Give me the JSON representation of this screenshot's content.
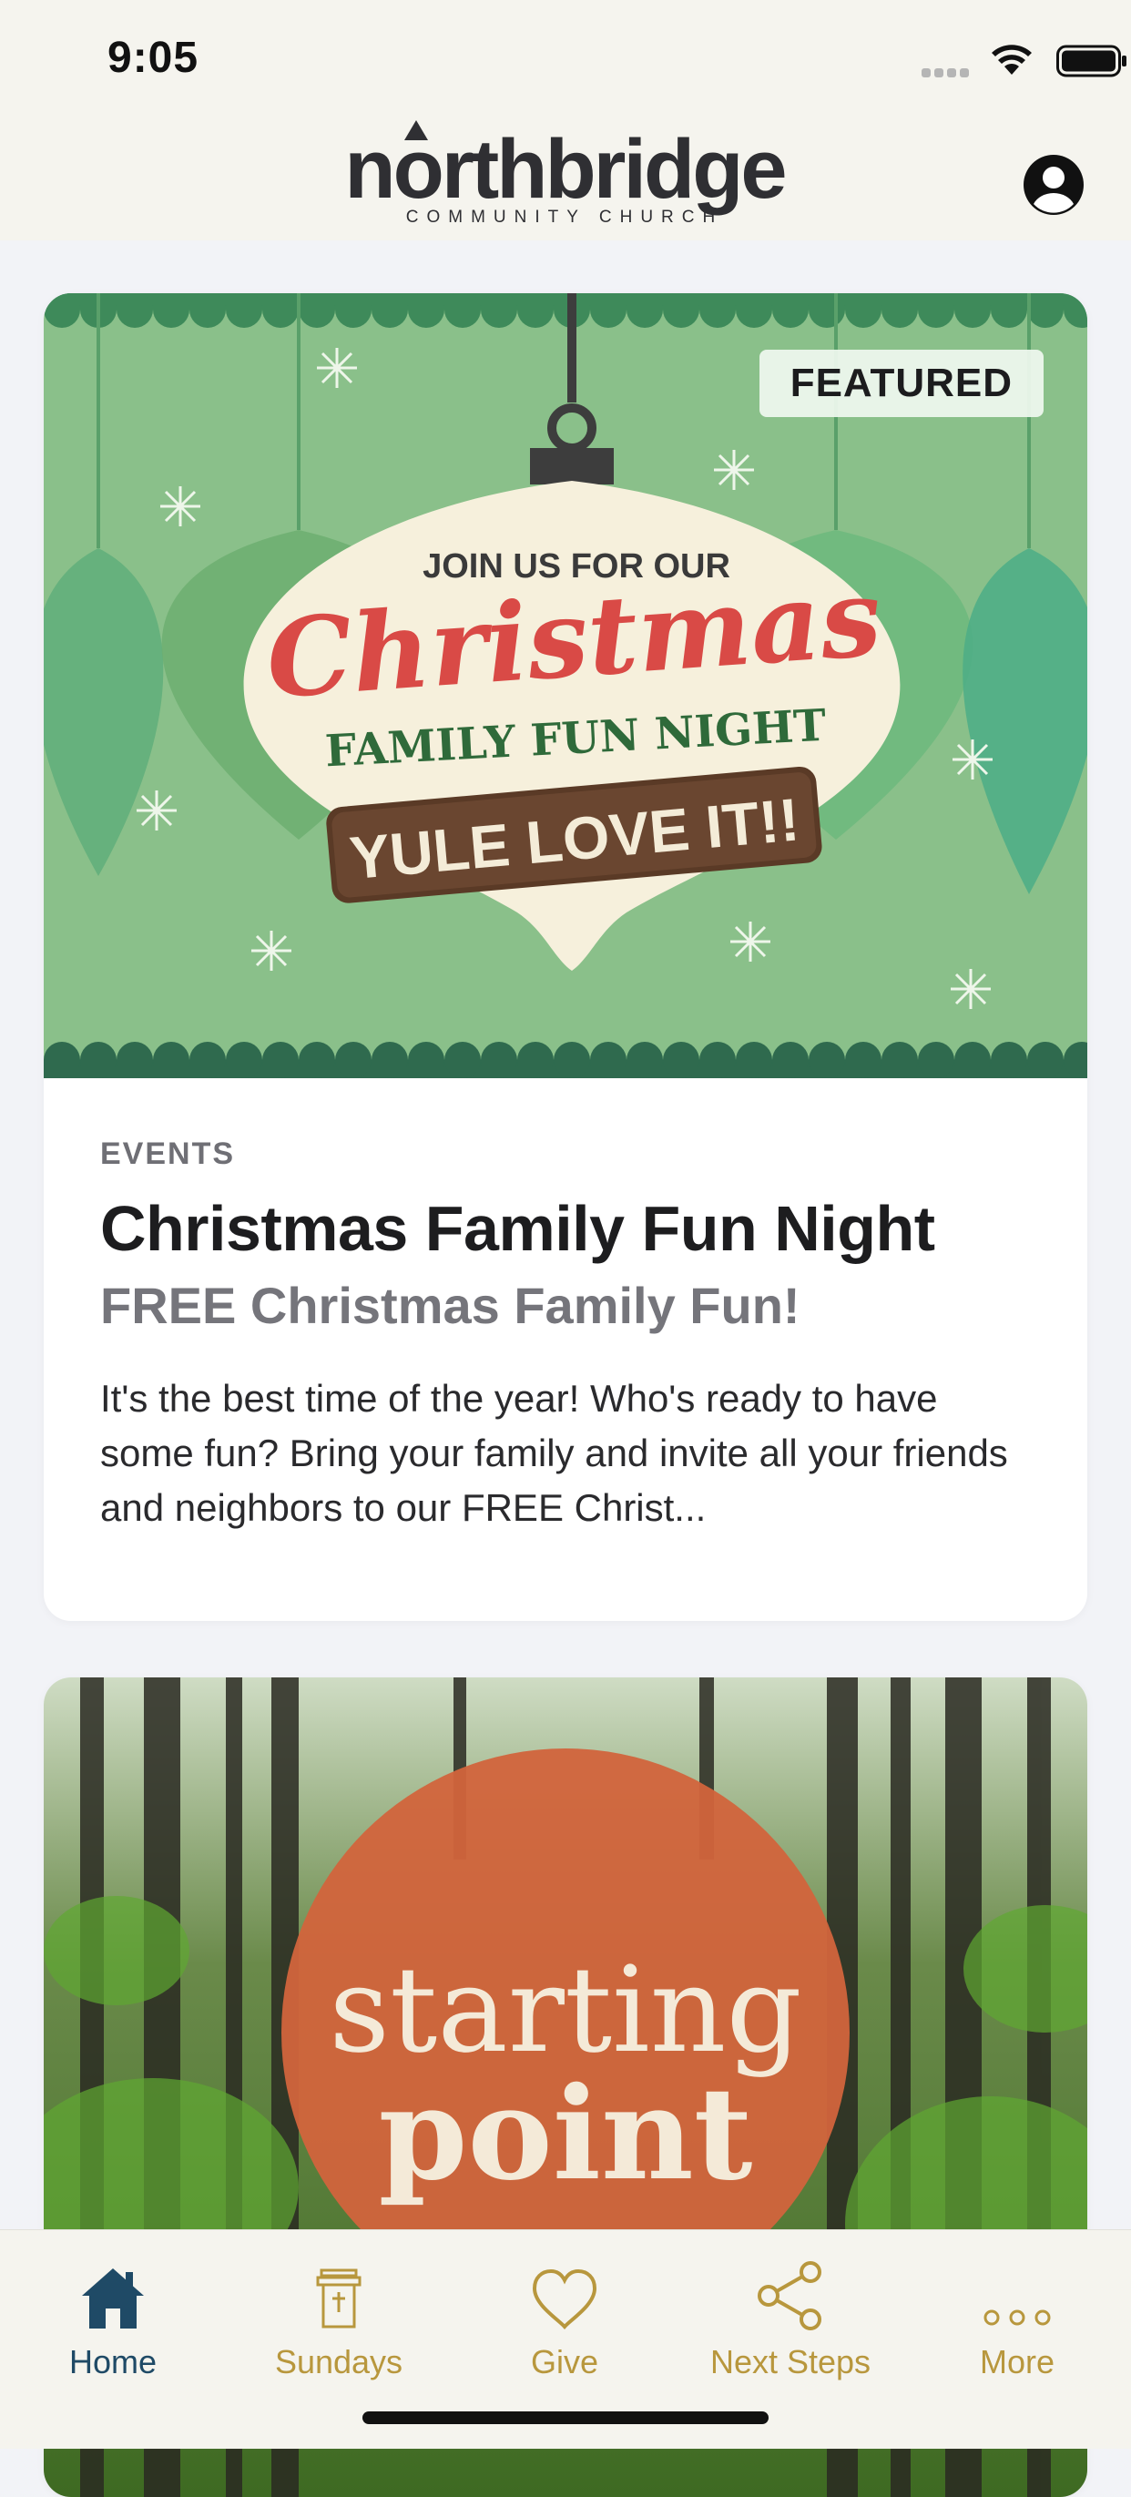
{
  "status": {
    "time": "9:05"
  },
  "header": {
    "logo_main": "northbridge",
    "logo_sub": "COMMUNITY CHURCH",
    "profile_icon": "person-circle-icon"
  },
  "feed": {
    "cards": [
      {
        "badge": "FEATURED",
        "image_text": {
          "line1": "JOIN US FOR OUR",
          "line2": "Christmas",
          "line3": "FAMILY FUN NIGHT",
          "line4": "YULE LOVE IT!!"
        },
        "category": "EVENTS",
        "title": "Christmas Family Fun Night",
        "subtitle": "FREE Christmas Family Fun!",
        "summary": "It's the best time of the year! Who's ready to have some fun? Bring your family and invite all your friends and neighbors to our FREE Christ..."
      },
      {
        "image_text": {
          "line1": "starting",
          "line2": "point"
        }
      }
    ]
  },
  "tabbar": {
    "tabs": [
      {
        "label": "Home",
        "icon": "home-icon",
        "active": true
      },
      {
        "label": "Sundays",
        "icon": "pulpit-icon",
        "active": false
      },
      {
        "label": "Give",
        "icon": "heart-icon",
        "active": false
      },
      {
        "label": "Next Steps",
        "icon": "share-nodes-icon",
        "active": false
      },
      {
        "label": "More",
        "icon": "more-dots-icon",
        "active": false
      }
    ],
    "active_color": "#1f4a66",
    "inactive_color": "#b8973d"
  }
}
